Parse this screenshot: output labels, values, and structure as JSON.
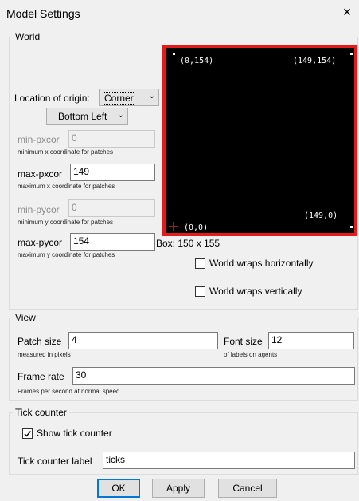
{
  "window": {
    "title": "Model Settings",
    "close": "×"
  },
  "world": {
    "legend": "World",
    "location_label": "Location of origin:",
    "location_value": "Corner",
    "corner_value": "Bottom Left",
    "min_pxcor": {
      "label": "min-pxcor",
      "value": "0",
      "hint": "minimum x coordinate for patches"
    },
    "max_pxcor": {
      "label": "max-pxcor",
      "value": "149",
      "hint": "maximum x coordinate for patches"
    },
    "min_pycor": {
      "label": "min-pycor",
      "value": "0",
      "hint": "minimum y coordinate for patches"
    },
    "max_pycor": {
      "label": "max-pycor",
      "value": "154",
      "hint": "maximum y coordinate for patches"
    },
    "preview": {
      "top_left": "(0,154)",
      "top_right": "(149,154)",
      "bottom_left": "(0,0)",
      "bottom_right": "(149,0)",
      "border_color": "#e31b1b",
      "background": "#000000"
    },
    "box_label": "Box: 150 x 155",
    "wrap_horizontal": {
      "label": "World wraps horizontally",
      "checked": false
    },
    "wrap_vertical": {
      "label": "World wraps vertically",
      "checked": false
    }
  },
  "view": {
    "legend": "View",
    "patch_size": {
      "label": "Patch size",
      "value": "4",
      "hint": "measured in pixels"
    },
    "font_size": {
      "label": "Font size",
      "value": "12",
      "hint": "of labels on agents"
    },
    "frame_rate": {
      "label": "Frame rate",
      "value": "30",
      "hint": "Frames per second at normal speed"
    }
  },
  "tick": {
    "legend": "Tick counter",
    "show_label": "Show tick counter",
    "show_checked": true,
    "label_label": "Tick counter label",
    "label_value": "ticks"
  },
  "buttons": {
    "ok": "OK",
    "apply": "Apply",
    "cancel": "Cancel"
  }
}
